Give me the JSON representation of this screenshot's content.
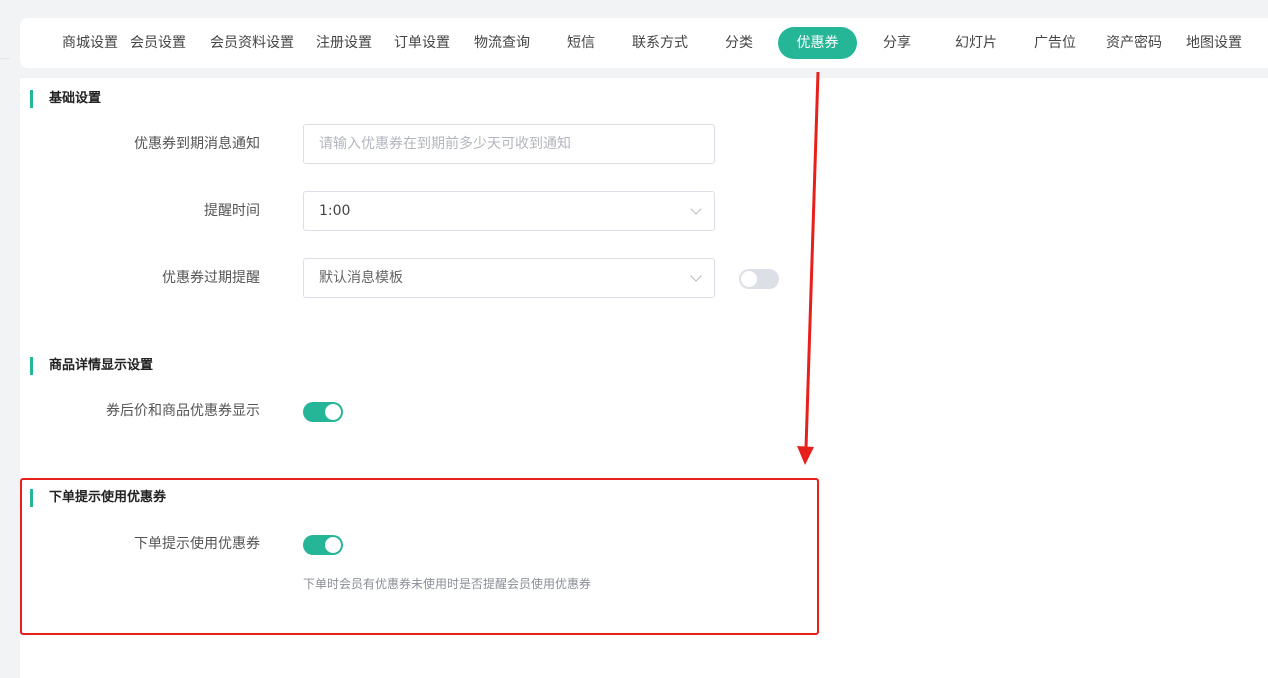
{
  "tabs": [
    {
      "label": "商城设置",
      "active": false
    },
    {
      "label": "会员设置",
      "active": false
    },
    {
      "label": "会员资料设置",
      "active": false
    },
    {
      "label": "注册设置",
      "active": false
    },
    {
      "label": "订单设置",
      "active": false
    },
    {
      "label": "物流查询",
      "active": false
    },
    {
      "label": "短信",
      "active": false
    },
    {
      "label": "联系方式",
      "active": false
    },
    {
      "label": "分类",
      "active": false
    },
    {
      "label": "优惠券",
      "active": true
    },
    {
      "label": "分享",
      "active": false
    },
    {
      "label": "幻灯片",
      "active": false
    },
    {
      "label": "广告位",
      "active": false
    },
    {
      "label": "资产密码",
      "active": false
    },
    {
      "label": "地图设置",
      "active": false
    }
  ],
  "basic": {
    "title": "基础设置",
    "expire_notice_label": "优惠券到期消息通知",
    "expire_notice_placeholder": "请输入优惠券在到期前多少天可收到通知",
    "remind_time_label": "提醒时间",
    "remind_time_value": "1:00",
    "expire_remind_label": "优惠券过期提醒",
    "expire_remind_value": "默认消息模板",
    "expire_remind_enabled": false
  },
  "goods_detail": {
    "title": "商品详情显示设置",
    "price_display_label": "券后价和商品优惠券显示",
    "price_display_enabled": true
  },
  "order_prompt": {
    "title": "下单提示使用优惠券",
    "toggle_label": "下单提示使用优惠券",
    "toggle_enabled": true,
    "hint": "下单时会员有优惠券未使用时是否提醒会员使用优惠券"
  },
  "colors": {
    "accent": "#25b697",
    "annotation": "#e8201c"
  }
}
